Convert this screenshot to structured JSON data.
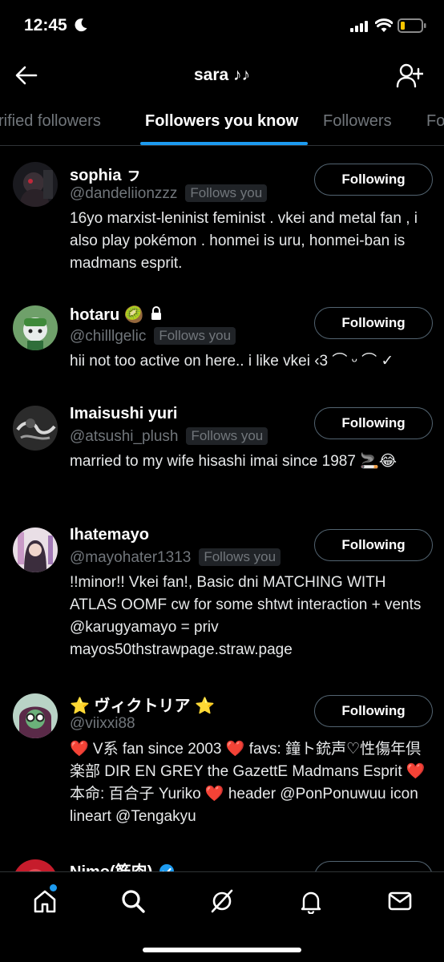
{
  "status_bar": {
    "time": "12:45"
  },
  "header": {
    "title": "sara ♪♪"
  },
  "tabs": [
    {
      "label": "rified followers"
    },
    {
      "label": "Followers you know"
    },
    {
      "label": "Followers"
    },
    {
      "label": "Fo"
    }
  ],
  "users": [
    {
      "name": "sophia ㇷ",
      "handle": "@dandeliionzzz",
      "badge": "Follows you",
      "button": "Following",
      "bio": "16yo marxist-leninist feminist . vkei and metal fan , i also play pokémon . honmei is uru, honmei-ban is madmans esprit."
    },
    {
      "name": "hotaru 🥝",
      "handle": "@chilllgelic",
      "badge": "Follows you",
      "button": "Following",
      "bio": "hii not too active on here.. i like vkei ‹3 ⌒ ᵕ ⌒ ✓"
    },
    {
      "name": "Imaisushi yuri",
      "handle": "@atsushi_plush",
      "badge": "Follows you",
      "button": "Following",
      "bio": "married to my wife hisashi imai since 1987 🚬😂"
    },
    {
      "name": "Ihatemayo",
      "handle": "@mayohater1313",
      "badge": "Follows you",
      "button": "Following",
      "bio": "!!minor!! Vkei fan!, Basic dni MATCHING WITH ATLAS OOMF cw for some shtwt interaction + vents @karugyamayo = priv mayos50thstrawpage.straw.page"
    },
    {
      "name": "⭐ ヴィクトリア ⭐",
      "handle": "@viixxi88",
      "badge": "",
      "button": "Following",
      "bio": "❤️ V系 fan since 2003 ❤️ favs: 鐘ト銃声♡性傷年倶楽部 DIR EN GREY the GazettE Madmans Esprit ❤️ 本命: 百合子 Yuriko ❤️ header @PonPonuwuu icon lineart @Tengakyu"
    },
    {
      "name": "Nimo(筋肉)",
      "handle": "",
      "badge": "",
      "button": "Following",
      "bio": ""
    }
  ],
  "colors": {
    "accent": "#1d9bf0",
    "background": "#000000",
    "secondary_text": "#71767b"
  },
  "icons": {
    "header": [
      "back-arrow-icon",
      "add-user-icon"
    ],
    "bottom_nav": [
      "home-icon",
      "search-icon",
      "spaces-icon",
      "notifications-icon",
      "messages-icon"
    ]
  }
}
